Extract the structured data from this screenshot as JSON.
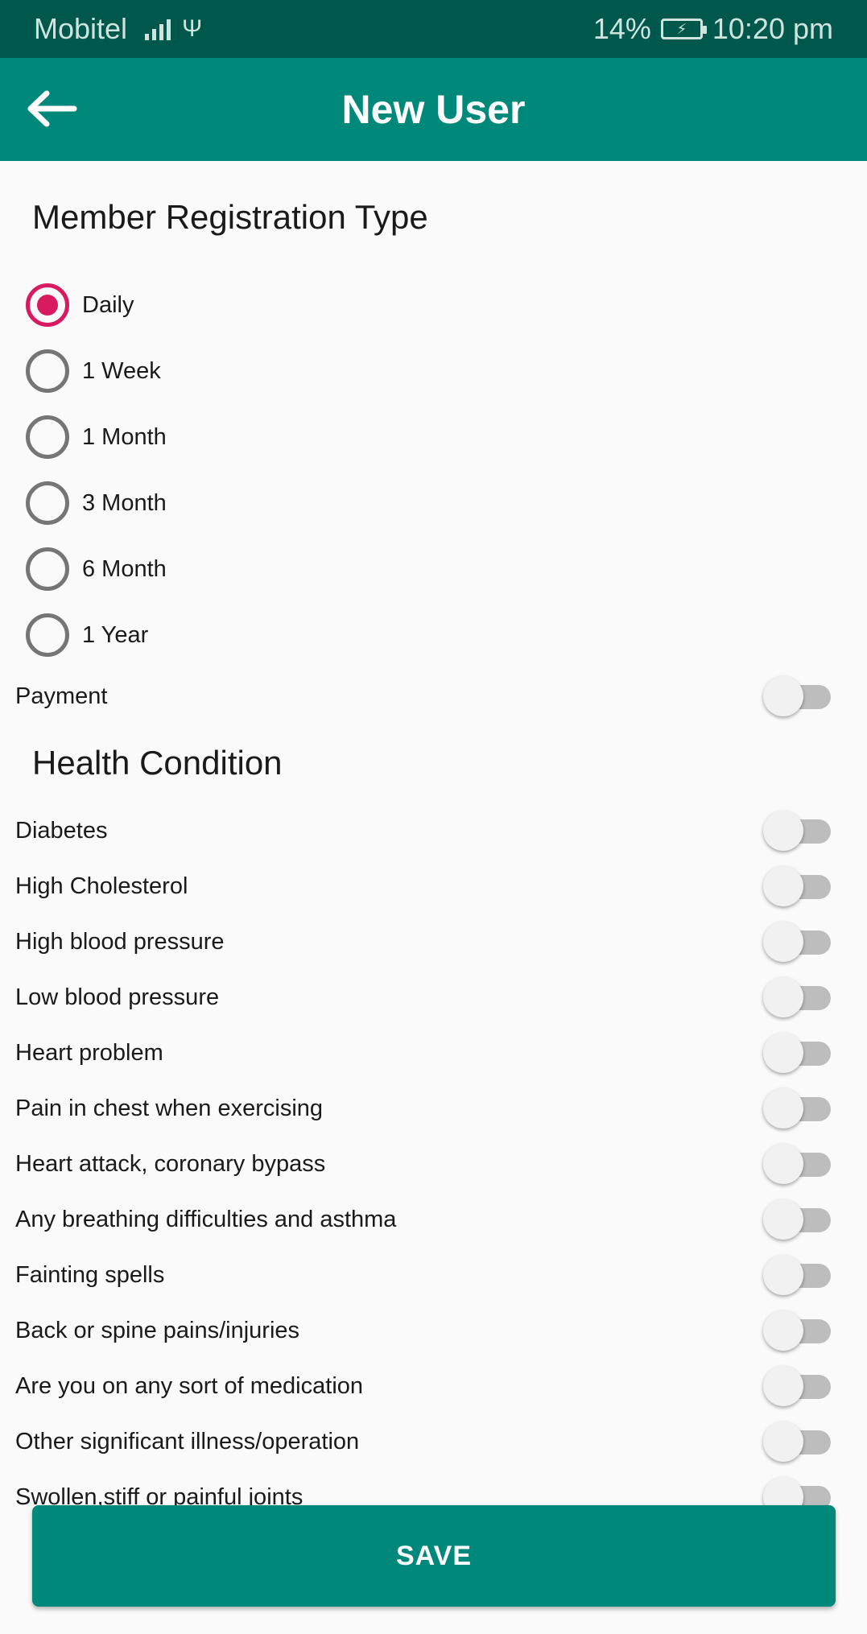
{
  "status_bar": {
    "carrier": "Mobitel",
    "battery": "14%",
    "time": "10:20 pm"
  },
  "app_bar": {
    "title": "New User",
    "back_icon": "arrow-back-icon"
  },
  "registration": {
    "title": "Member Registration Type",
    "options": [
      {
        "label": "Daily",
        "selected": true
      },
      {
        "label": "1 Week",
        "selected": false
      },
      {
        "label": "1 Month",
        "selected": false
      },
      {
        "label": "3 Month",
        "selected": false
      },
      {
        "label": "6 Month",
        "selected": false
      },
      {
        "label": "1 Year",
        "selected": false
      }
    ]
  },
  "payment": {
    "label": "Payment",
    "on": false
  },
  "health": {
    "title": "Health Condition",
    "items": [
      {
        "label": "Diabetes",
        "on": false
      },
      {
        "label": "High Cholesterol",
        "on": false
      },
      {
        "label": "High blood pressure",
        "on": false
      },
      {
        "label": "Low blood pressure",
        "on": false
      },
      {
        "label": "Heart problem",
        "on": false
      },
      {
        "label": "Pain in chest when exercising",
        "on": false
      },
      {
        "label": "Heart attack, coronary bypass",
        "on": false
      },
      {
        "label": "Any breathing difficulties and asthma",
        "on": false
      },
      {
        "label": "Fainting spells",
        "on": false
      },
      {
        "label": "Back or spine pains/injuries",
        "on": false
      },
      {
        "label": "Are you on any sort of medication",
        "on": false
      },
      {
        "label": "Other significant illness/operation",
        "on": false
      },
      {
        "label": "Swollen,stiff or painful joints",
        "on": false
      }
    ]
  },
  "save_label": "SAVE",
  "colors": {
    "status_bar": "#00574b",
    "app_bar": "#00897b",
    "accent": "#d81b60",
    "background": "#fafafa"
  }
}
